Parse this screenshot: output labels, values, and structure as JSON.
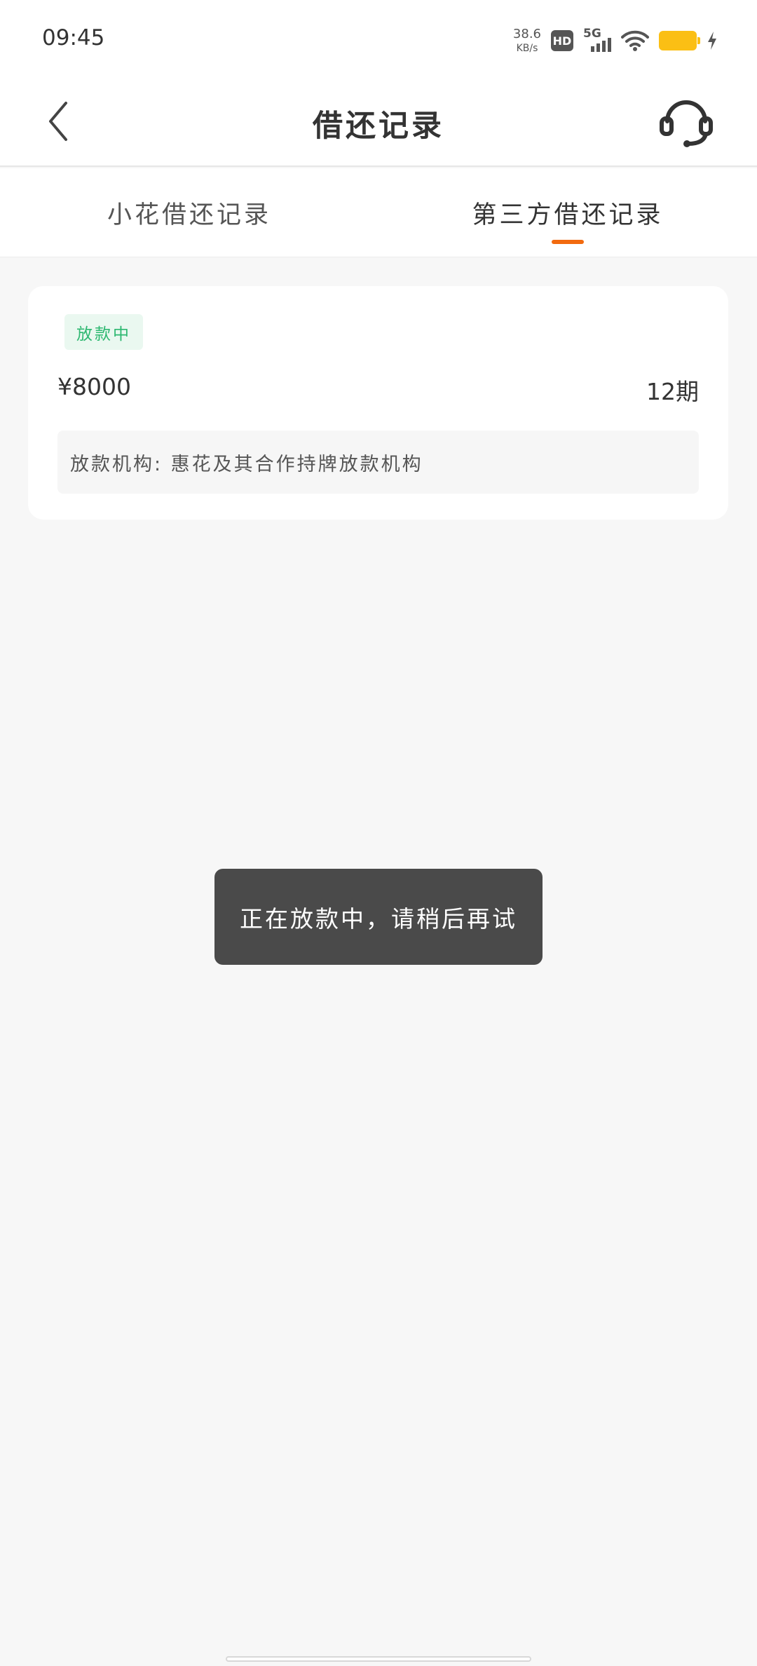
{
  "status_bar": {
    "time": "09:45",
    "net_speed_value": "38.6",
    "net_speed_unit": "KB/s",
    "hd_label": "HD",
    "network_label": "5G",
    "battery_color": "#fbbf14"
  },
  "nav": {
    "title": "借还记录",
    "back_icon": "chevron-left-icon",
    "service_icon": "headset-icon"
  },
  "tabs": [
    {
      "label": "小花借还记录",
      "active": false
    },
    {
      "label": "第三方借还记录",
      "active": true
    }
  ],
  "card": {
    "status": "放款中",
    "amount": "¥8000",
    "periods": "12期",
    "lender": "放款机构: 惠花及其合作持牌放款机构"
  },
  "toast": {
    "message": "正在放款中，请稍后再试"
  },
  "colors": {
    "accent": "#f26a0f",
    "status_green": "#2eb871",
    "status_green_bg": "#eaf8f0",
    "toast_bg": "#4a4a4a"
  }
}
